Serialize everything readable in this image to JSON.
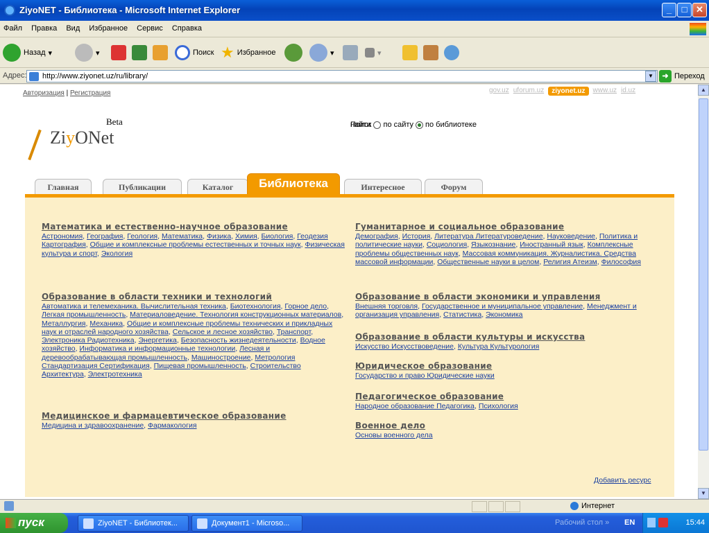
{
  "window": {
    "title": "ZiyoNET - Библиотека - Microsoft Internet Explorer"
  },
  "menu": [
    "Файл",
    "Правка",
    "Вид",
    "Избранное",
    "Сервис",
    "Справка"
  ],
  "toolbar": {
    "back": "Назад",
    "search": "Поиск",
    "favorites": "Избранное"
  },
  "address": {
    "label": "Адрес:",
    "url": "http://www.ziyonet.uz/ru/library/",
    "go": "Переход"
  },
  "page": {
    "auth": {
      "login": "Авторизация",
      "sep": "|",
      "register": "Регистрация"
    },
    "sites": [
      "gov.uz",
      "uforum.uz",
      "ziyonet.uz",
      "www.uz",
      "id.uz"
    ],
    "active_site": "ziyonet.uz",
    "logo": {
      "beta": "Beta",
      "name_a": "Zi",
      "name_b": "y",
      "name_c": "ONet"
    },
    "search": {
      "label": "Поиск",
      "opt1": "по сайту",
      "opt2": "по библиотеке",
      "button": "найти"
    },
    "tabs": [
      "Главная",
      "Публикации",
      "Каталог",
      "Библиотека",
      "Интересное",
      "Форум"
    ],
    "active_tab": "Библиотека",
    "left": [
      {
        "title": "Математика и естественно-научное образование",
        "items": [
          "Астрономия",
          "География",
          "Геология",
          "Математика",
          "Физика",
          "Химия",
          "Биология",
          "Геодезия Картография",
          "Общие и комплексные проблемы естественных и точных наук",
          "Физическая культура и спорт",
          "Экология"
        ]
      },
      {
        "title": "Образование в области техники и технологий",
        "items": [
          "Автоматика и телемеханика. Вычислительная техника",
          "Биотехнология",
          "Горное дело",
          "Легкая промышленность",
          "Материаловедение. Технология конструкционных материалов",
          "Металлургия",
          "Механика",
          "Общие и комплексные проблемы технических и прикладных наук и отраслей народного хозяйства",
          "Сельское и лесное хозяйство",
          "Транспорт",
          "Электроника Радиотехника",
          "Энергетика",
          "Безопасность жизнедеятельности",
          "Водное хозяйство",
          "Информатика и информационные технологии",
          "Лесная и деревообрабатывающая промышленность",
          "Машиностроение",
          "Метрология Стандартизация Сертификация",
          "Пищевая промышленность",
          "Строительство Архитектура",
          "Электротехника"
        ]
      },
      {
        "title": "Медицинское и фармацевтическое образование",
        "items": [
          "Медицина и здравоохранение",
          "Фармакология"
        ]
      }
    ],
    "right": [
      {
        "title": "Гуманитарное и социальное образование",
        "items": [
          "Демография",
          "История",
          "Литература Литературоведение",
          "Науковедение",
          "Политика и политические науки",
          "Социология",
          "Языкознание",
          "Иностранный язык",
          "Комплексные проблемы общественных наук",
          "Массовая коммуникация. Журналистика. Средства массовой информации",
          "Общественные науки в целом",
          "Религия Атеизм",
          "Философия"
        ]
      },
      {
        "title": "Образование в области экономики и управления",
        "items": [
          "Внешняя торговля",
          "Государственное и муниципальное управление",
          "Менеджмент и организация управления",
          "Статистика",
          "Экономика"
        ]
      },
      {
        "title": "Образование в области культуры и искусства",
        "items": [
          "Искусство Искусствоведение",
          "Культура Культурология"
        ]
      },
      {
        "title": "Юридическое образование",
        "items": [
          "Государство и право Юридические науки"
        ]
      },
      {
        "title": "Педагогическое образование",
        "items": [
          "Народное образование Педагогика",
          "Психология"
        ]
      },
      {
        "title": "Военное дело",
        "items": [
          "Основы военного дела"
        ]
      }
    ],
    "add_resource": "Добавить ресурс"
  },
  "status": {
    "zone": "Интернет"
  },
  "taskbar": {
    "start": "пуск",
    "tasks": [
      "ZiyoNET - Библиотек...",
      "Документ1 - Microso..."
    ],
    "desktop": "Рабочий стол",
    "lang": "EN",
    "time": "15:44"
  }
}
